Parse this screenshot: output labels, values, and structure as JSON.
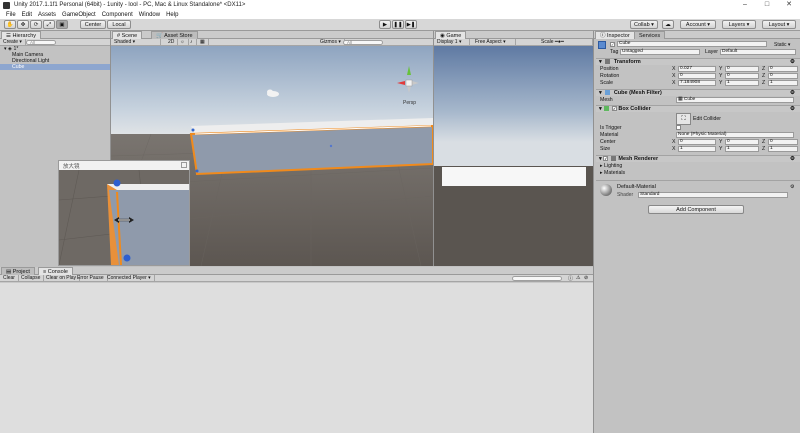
{
  "window": {
    "title": "Unity 2017.1.1f1 Personal (64bit) - 1unity - lool - PC, Mac & Linux Standalone* <DX11>",
    "controls": [
      "–",
      "□",
      "✕"
    ]
  },
  "menu": [
    "File",
    "Edit",
    "Assets",
    "GameObject",
    "Component",
    "Window",
    "Help"
  ],
  "toolbar": {
    "pivot_label": "Center",
    "space_label": "Local",
    "collab_label": "Collab ▾",
    "account_label": "Account ▾",
    "layers_label": "Layers",
    "layout_label": "Layout"
  },
  "hierarchy": {
    "tab": "Hierarchy",
    "create_label": "Create ▾",
    "search_placeholder": "All",
    "scene_name": "1*",
    "items": [
      {
        "label": "Main Camera",
        "selected": false
      },
      {
        "label": "Directional Light",
        "selected": false
      },
      {
        "label": "Cube",
        "selected": true
      }
    ]
  },
  "scene": {
    "tabs": [
      "Scene",
      "Asset Store"
    ],
    "shading": "Shaded",
    "mode_2d": "2D",
    "gizmos": "Gizmos ▾",
    "search_placeholder": "All",
    "persp": "Persp"
  },
  "magnifier": {
    "title": "放大镜"
  },
  "game": {
    "tab": "Game",
    "display": "Display 1",
    "aspect": "Free Aspect",
    "scale": "Scale"
  },
  "project": {
    "tabs": [
      "Project",
      "Console"
    ],
    "buttons": [
      "Clear",
      "Collapse",
      "Clear on Play",
      "Error Pause",
      "Connected Player ▾"
    ]
  },
  "inspector": {
    "tabs": [
      "Inspector",
      "Services"
    ],
    "object_name": "Cube",
    "static_label": "Static ▾",
    "tag_label": "Tag",
    "tag_value": "Untagged",
    "layer_label": "Layer",
    "layer_value": "Default",
    "transform": {
      "title": "Transform",
      "rows": [
        {
          "label": "Position",
          "x": "0.027",
          "y": "0",
          "z": "0"
        },
        {
          "label": "Rotation",
          "x": "0",
          "y": "0",
          "z": "0"
        },
        {
          "label": "Scale",
          "x": "7.184908",
          "y": "1",
          "z": "1"
        }
      ]
    },
    "mesh_filter": {
      "title": "Cube (Mesh Filter)",
      "mesh_label": "Mesh",
      "mesh_value": "Cube"
    },
    "box_collider": {
      "title": "Box Collider",
      "edit_label": "Edit Collider",
      "is_trigger_label": "Is Trigger",
      "material_label": "Material",
      "material_value": "None (Physic Material)",
      "center_label": "Center",
      "center": {
        "x": "0",
        "y": "0",
        "z": "0"
      },
      "size_label": "Size",
      "size": {
        "x": "1",
        "y": "1",
        "z": "1"
      }
    },
    "mesh_renderer": {
      "title": "Mesh Renderer",
      "lighting": "Lighting",
      "materials": "Materials"
    },
    "material": {
      "name": "Default-Material",
      "shader_label": "Shader",
      "shader_value": "Standard"
    },
    "add_component": "Add Component"
  }
}
